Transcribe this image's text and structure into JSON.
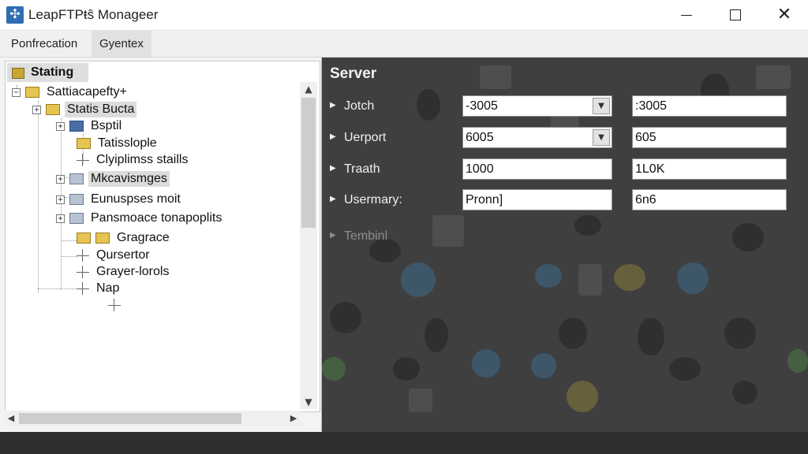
{
  "window": {
    "title": "LeapFTPŧŝ Monageer",
    "icon": "app-logo-icon",
    "controls": [
      "minimize-icon",
      "maximize-icon",
      "close-icon"
    ]
  },
  "menu": [
    "Ponfrecation",
    "Gyentex"
  ],
  "tree": {
    "header": "Stating",
    "nodes": [
      {
        "label": "Sattiacapefty+"
      },
      {
        "label": "Statis Bucta"
      },
      {
        "label": "Bsptil"
      },
      {
        "label": "Tatisslople"
      },
      {
        "label": "Clyiplimss staills"
      },
      {
        "label": "Mkcavismges"
      },
      {
        "label": "Eunuspses moit"
      },
      {
        "label": "Pansmoace tonapoplits"
      },
      {
        "label": "Gragrace"
      },
      {
        "label": "Qursertor"
      },
      {
        "label": "Grayer-lorols"
      },
      {
        "label": "Nap"
      }
    ]
  },
  "properties": {
    "title": "Server",
    "rows": [
      {
        "label": "Jotch",
        "value1": "-3005",
        "value2": ":3005",
        "combo": true
      },
      {
        "label": "Uerport",
        "value1": "6005",
        "value2": "605",
        "combo": true
      },
      {
        "label": "Traath",
        "value1": "1000",
        "value2": "1L0K",
        "combo": false
      },
      {
        "label": "Usermary:",
        "value1": "Pronn]",
        "value2": "6n6",
        "combo": false
      },
      {
        "label": "Tembinl",
        "disabled": true
      }
    ]
  }
}
